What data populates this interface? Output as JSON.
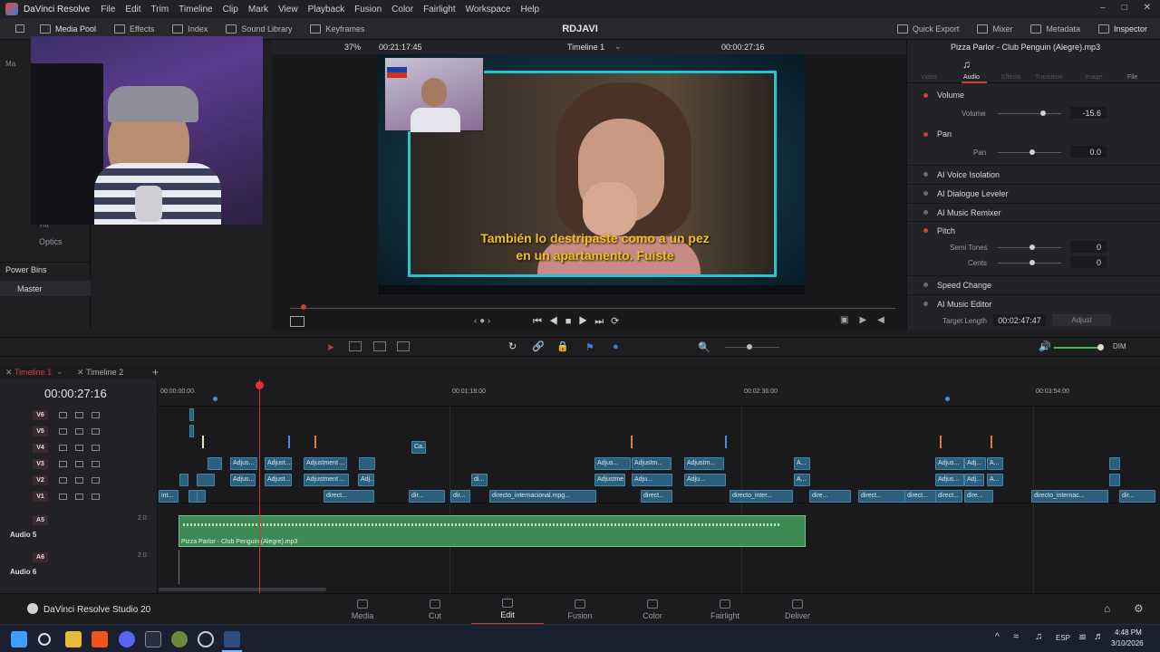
{
  "titlebar": {
    "app": "DaVinci Resolve",
    "menus": [
      "File",
      "Edit",
      "Trim",
      "Timeline",
      "Clip",
      "Mark",
      "View",
      "Playback",
      "Fusion",
      "Color",
      "Fairlight",
      "Workspace",
      "Help"
    ]
  },
  "toolbar": {
    "left": [
      "Media Pool",
      "Effects",
      "Index",
      "Sound Library",
      "Keyframes"
    ],
    "project": "RDJAVI",
    "right": [
      "Quick Export",
      "Mixer",
      "Metadata",
      "Inspector"
    ]
  },
  "viewer": {
    "zoom": "37%",
    "source_tc": "00:21:17:45",
    "timeline_name": "Timeline 1",
    "record_tc": "00:00:27:16",
    "subtitle_line1": "También lo destripaste como a un pez",
    "subtitle_line2": "en un apartamento. Fuiste"
  },
  "leftpanel": {
    "items": [
      "Ma",
      "Hit",
      "Optics",
      "Power Bins",
      "Master"
    ]
  },
  "inspector": {
    "clip_name": "Pizza Parlor - Club Penguin (Alegre).mp3",
    "tabs": [
      "Video",
      "Audio",
      "Effects",
      "Transition",
      "Image",
      "File"
    ],
    "sections": {
      "volume": {
        "label": "Volume",
        "sub": "Volume",
        "value": "-15.6"
      },
      "pan": {
        "label": "Pan",
        "sub": "Pan",
        "value": "0.0"
      },
      "voice_isolation": "AI Voice Isolation",
      "dialogue_leveler": "AI Dialogue Leveler",
      "music_remixer": "AI Music Remixer",
      "pitch": {
        "label": "Pitch",
        "semi_label": "Semi Tones",
        "semi_value": "0",
        "cents_label": "Cents",
        "cents_value": "0"
      },
      "speed_change": "Speed Change",
      "music_editor": "AI Music Editor",
      "target_length_label": "Target Length",
      "target_length_value": "00:02:47:47",
      "adjust": "Adjust"
    }
  },
  "timeline": {
    "tabs": [
      "Timeline 1",
      "Timeline 2"
    ],
    "timecode": "00:00:27:16",
    "ruler": [
      "00:00:00:00",
      "00:01:18:00",
      "00:02:36:00",
      "00:03:54:00"
    ],
    "tracks_video": [
      "V6",
      "V5",
      "V4",
      "V3",
      "V2",
      "V1"
    ],
    "tracks_audio": [
      {
        "id": "A5",
        "name": "Audio 5",
        "level": "2.0"
      },
      {
        "id": "A6",
        "name": "Audio 6",
        "level": "2.0"
      }
    ],
    "audio_clip": "Pizza Parlor - Club Penguin (Alegre).mp3",
    "clips_text": [
      "Adjus...",
      "Adjus...",
      "Adjust...",
      "Adjust...",
      "Adjustment ...",
      "Adj...",
      "Adjus...",
      "Adjustme...",
      "Adjustm...",
      "Adju...",
      "Ca...",
      "di...",
      "int...",
      "direct...",
      "dir...",
      "dir...",
      "directo_internacional.mpg...",
      "direct...",
      "directo_inter...",
      "dire...",
      "direct...",
      "direct...",
      "direct...",
      "dire...",
      "directo_internac...",
      "dir...",
      "A...",
      "Adjus...",
      "Adj...",
      "A..."
    ]
  },
  "pages": [
    "Media",
    "Cut",
    "Edit",
    "Fusion",
    "Color",
    "Fairlight",
    "Deliver"
  ],
  "active_page": "Edit",
  "brand": "DaVinci Resolve Studio 20",
  "tray": {
    "lang": "ESP",
    "time": "4:48 PM",
    "date": "3/10/2026"
  },
  "audio_meter_label": "DIM",
  "colors": {
    "accent": "#d23b3b",
    "clip_blue": "#2b5f7c",
    "audio_green": "#3e8a54",
    "subtitle_yellow": "#f2c21b"
  }
}
